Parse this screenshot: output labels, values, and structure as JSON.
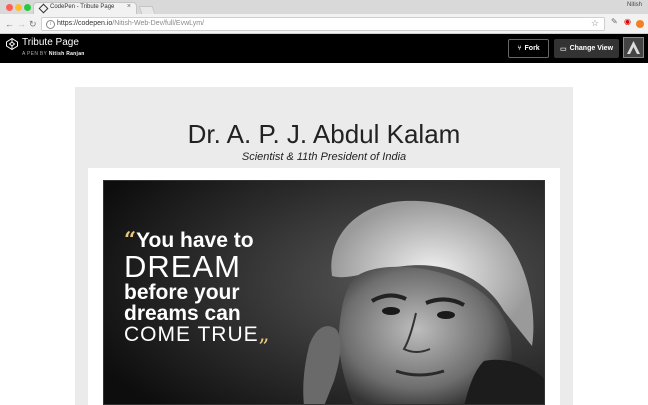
{
  "browser": {
    "tab_title": "CodePen - Tribute Page",
    "tab_close": "×",
    "user_name": "Nitish",
    "url_domain": "https://codepen.io",
    "url_path": "/Nitish-Web-Dev/full/EvwLym/"
  },
  "codepen": {
    "title": "Tribute Page",
    "by_prefix": "A PEN BY",
    "author": "Nitish Ranjan",
    "fork_label": "Fork",
    "change_view_label": "Change View"
  },
  "page": {
    "title": "Dr. A. P. J. Abdul Kalam",
    "subtitle": "Scientist & 11th President of India"
  },
  "image_quote": {
    "open_mark": "“",
    "line1": "You have to",
    "line2": "DREAM",
    "line3": "before your",
    "line4": "dreams can",
    "line5": "COME TRUE",
    "close_mark": "„"
  },
  "colors": {
    "header_bg": "#000000",
    "panel_bg": "#ebebeb",
    "quote_mark": "#e8c77a"
  }
}
